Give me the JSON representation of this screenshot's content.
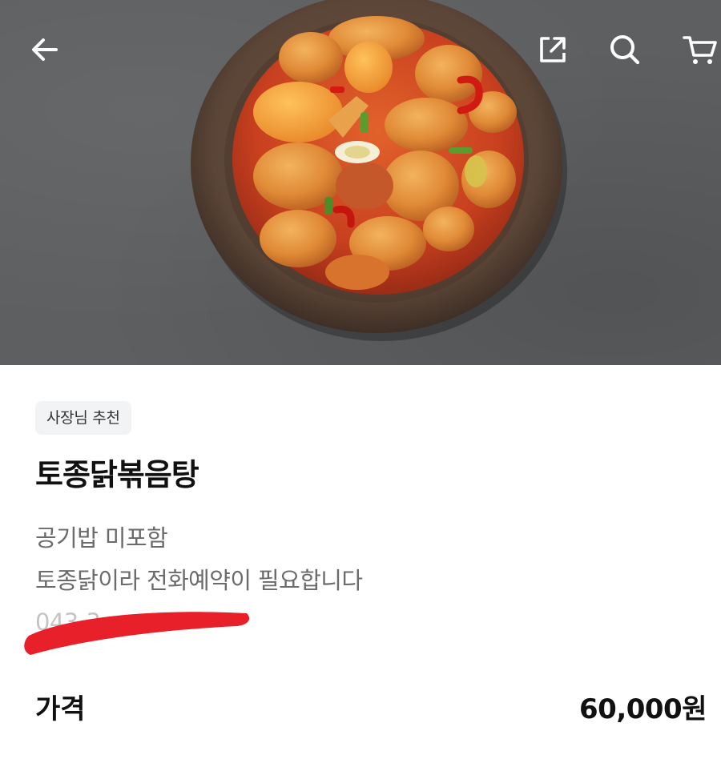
{
  "hero": {
    "image_subject": "stewed-chicken-dish-photo",
    "icons": {
      "back": "arrow-left-icon",
      "share": "share-external-icon",
      "search": "search-icon",
      "cart": "cart-icon"
    }
  },
  "product": {
    "badge": "사장님 추천",
    "title": "토종닭볶음탕",
    "description": [
      "공기밥 미포함",
      "토종닭이라 전화예약이 필요합니다",
      "043-3"
    ]
  },
  "price": {
    "label": "가격",
    "value": "60,000원"
  },
  "colors": {
    "redaction": "#e8202a",
    "badge_bg": "#f1f3f5",
    "background_photo": "#5d5f61"
  }
}
